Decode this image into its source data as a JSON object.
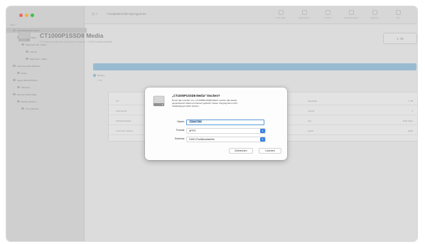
{
  "window": {
    "title": "Festplattendienstprogramm"
  },
  "sidebar": {
    "section": "Intern",
    "items": [
      {
        "label": "CT1000P1SSD8 Media",
        "depth": 0,
        "selected": true
      },
      {
        "label": "Container disk1",
        "depth": 1,
        "selected": false
      },
      {
        "label": "Macintosh HD - Daten",
        "depth": 2,
        "selected": false
      },
      {
        "label": "Volume",
        "depth": 3,
        "selected": false
      },
      {
        "label": "Macintosh - Daten",
        "depth": 3,
        "selected": false
      },
      {
        "label": "Samsung SSD 860 EVO",
        "depth": 0,
        "selected": false
      },
      {
        "label": "Daten",
        "depth": 1,
        "selected": false
      },
      {
        "label": "Apple SSD AP0512M",
        "depth": 0,
        "selected": false
      },
      {
        "label": "Windows",
        "depth": 1,
        "selected": false
      },
      {
        "label": "Externer Datenträger",
        "depth": 0,
        "selected": false
      },
      {
        "label": "Backup Medium",
        "depth": 1,
        "selected": false
      },
      {
        "label": "Time Machine",
        "depth": 2,
        "selected": false
      }
    ]
  },
  "toolbar": {
    "buttons": [
      {
        "label": "Erste Hilfe",
        "icon": "stethoscope-icon"
      },
      {
        "label": "Partitionieren",
        "icon": "partition-icon"
      },
      {
        "label": "Löschen",
        "icon": "erase-icon"
      },
      {
        "label": "Wiederherstellen",
        "icon": "restore-icon"
      },
      {
        "label": "Aktivieren",
        "icon": "mount-icon"
      },
      {
        "label": "Info",
        "icon": "info-icon"
      }
    ]
  },
  "header": {
    "title": "CT1000P1SSD8 Media",
    "subtitle": "PCI-Express-internes physisches Volume · GUID-Partitionstabelle",
    "capacity": "1 TB"
  },
  "usage": {
    "legend": "Medium",
    "value": "1 TB"
  },
  "info_rows": [
    {
      "key": "Ort:",
      "value": "Intern"
    },
    {
      "key": "Verbindung:",
      "value": "PCI-Express"
    },
    {
      "key": "Partitionstabelle:",
      "value": "GUID-Partitionstabelle"
    },
    {
      "key": "S.M.A.R.T.-Status:",
      "value": "Nicht unterstützt"
    }
  ],
  "info_right": [
    {
      "key": "Kapazität:",
      "value": "1 TB"
    },
    {
      "key": "Anzahl:",
      "value": "3"
    },
    {
      "key": "Typ:",
      "value": "Solid State"
    },
    {
      "key": "Gerät:",
      "value": "disk0"
    }
  ],
  "dialog": {
    "title": "„CT1000P1SSD8 Media\" löschen?",
    "body_lines": [
      "Durch das Löschen von „CT1000P1SSD8 Media\" werden alle darauf",
      "gespeicherten Daten permanent gelöscht. Dieser Vorgang kann nicht",
      "rückgängig gemacht werden."
    ],
    "name_label": "Name:",
    "name_value": "Ohne Titel",
    "format_label": "Format:",
    "format_value": "APFS",
    "scheme_label": "Schema:",
    "scheme_value": "GUID-Partitionstabelle",
    "cancel_label": "Abbrechen",
    "erase_label": "Löschen"
  },
  "colors": {
    "accent": "#3a80e6",
    "usage_bar": "#9ac4e0",
    "close": "#fd5f57",
    "minimize": "#fdbc2e",
    "zoom": "#28c840"
  }
}
